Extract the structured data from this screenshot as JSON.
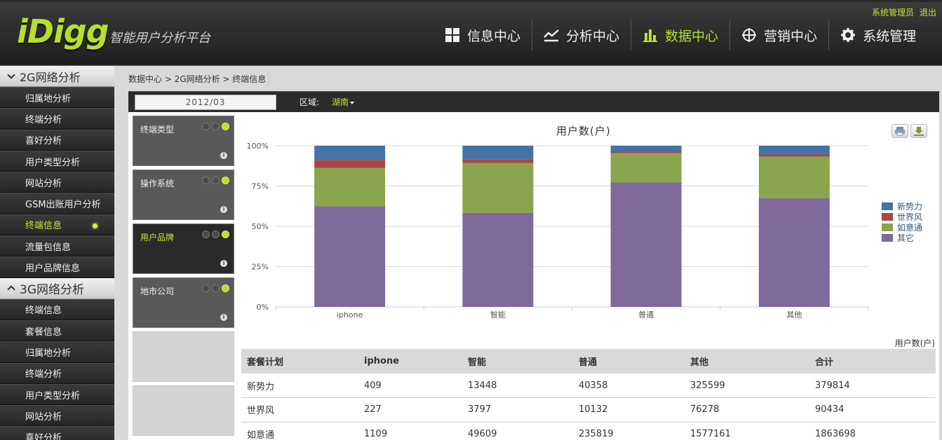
{
  "header": {
    "logo": "iDigg",
    "subtitle": "智能用户分析平台",
    "user_links": [
      "系统管理员",
      "退出"
    ],
    "nav": [
      {
        "label": "信息中心",
        "icon": "grid-icon",
        "active": false
      },
      {
        "label": "分析中心",
        "icon": "trend-icon",
        "active": false
      },
      {
        "label": "数据中心",
        "icon": "bar-chart-icon",
        "active": true
      },
      {
        "label": "营销中心",
        "icon": "crosshair-icon",
        "active": false
      },
      {
        "label": "系统管理",
        "icon": "gear-icon",
        "active": false
      }
    ]
  },
  "sidebar": {
    "sections": [
      {
        "title": "2G网络分析",
        "items": [
          {
            "label": "归属地分析",
            "active": false
          },
          {
            "label": "终端分析",
            "active": false
          },
          {
            "label": "喜好分析",
            "active": false
          },
          {
            "label": "用户类型分析",
            "active": false
          },
          {
            "label": "网站分析",
            "active": false
          },
          {
            "label": "GSM出账用户分析",
            "active": false
          },
          {
            "label": "终端信息",
            "active": true
          },
          {
            "label": "流量包信息",
            "active": false
          },
          {
            "label": "用户品牌信息",
            "active": false
          }
        ]
      },
      {
        "title": "3G网络分析",
        "items": [
          {
            "label": "终端信息",
            "active": false
          },
          {
            "label": "套餐信息",
            "active": false
          },
          {
            "label": "归属地分析",
            "active": false
          },
          {
            "label": "终端分析",
            "active": false
          },
          {
            "label": "用户类型分析",
            "active": false
          },
          {
            "label": "网站分析",
            "active": false
          },
          {
            "label": "喜好分析",
            "active": false
          }
        ]
      }
    ]
  },
  "breadcrumb": "数据中心 > 2G网络分析 > 终端信息",
  "filter": {
    "date": "2012/03",
    "region_label": "区域:",
    "region_value": "湖南"
  },
  "cards": [
    {
      "label": "终端类型",
      "active_light": 3,
      "selected": false
    },
    {
      "label": "操作系统",
      "active_light": 3,
      "selected": false
    },
    {
      "label": "用户品牌",
      "active_light": 3,
      "selected": true
    },
    {
      "label": "地市公司",
      "active_light": 3,
      "selected": false
    }
  ],
  "chart_data": {
    "type": "bar",
    "stacked": true,
    "percent": true,
    "title": "用户数(户)",
    "categories": [
      "iphone",
      "智能",
      "普通",
      "其他"
    ],
    "ylim": [
      0,
      100
    ],
    "yticks": [
      "0%",
      "25%",
      "50%",
      "75%",
      "100%"
    ],
    "legend_position": "right",
    "series": [
      {
        "name": "新势力",
        "color": "#4572a7",
        "values": [
          8.8,
          8.4,
          3.7,
          5.4
        ]
      },
      {
        "name": "世界风",
        "color": "#aa4643",
        "values": [
          4.9,
          2.4,
          0.9,
          1.3
        ]
      },
      {
        "name": "如意通",
        "color": "#89a54e",
        "values": [
          23.9,
          30.8,
          18.2,
          25.9
        ]
      },
      {
        "name": "其它",
        "color": "#80699b",
        "values": [
          62.4,
          58.4,
          77.2,
          67.4
        ]
      }
    ]
  },
  "table": {
    "unit": "用户数(户)",
    "headers": [
      "套餐计划",
      "iphone",
      "智能",
      "普通",
      "其他",
      "合计"
    ],
    "rows": [
      [
        "新势力",
        "409",
        "13448",
        "40358",
        "325599",
        "379814"
      ],
      [
        "世界风",
        "227",
        "3797",
        "10132",
        "76278",
        "90434"
      ],
      [
        "如意通",
        "1109",
        "49609",
        "235819",
        "1577161",
        "1863698"
      ]
    ]
  }
}
